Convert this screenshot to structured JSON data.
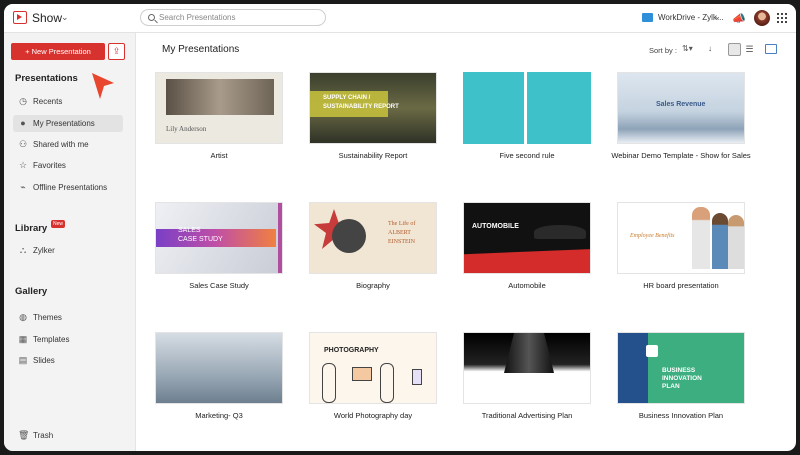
{
  "app": {
    "name": "Show"
  },
  "search": {
    "placeholder": "Search Presentations"
  },
  "workdrive": {
    "label": "WorkDrive - Zylk..."
  },
  "sidebar": {
    "new_button": "+ New Presentation",
    "sections": {
      "presentations": "Presentations",
      "library": "Library",
      "library_badge": "New",
      "gallery": "Gallery"
    },
    "items": [
      {
        "label": "Recents",
        "icon": "clock-icon"
      },
      {
        "label": "My Presentations",
        "icon": "user-icon"
      },
      {
        "label": "Shared with me",
        "icon": "shared-icon"
      },
      {
        "label": "Favorites",
        "icon": "star-icon"
      },
      {
        "label": "Offline Presentations",
        "icon": "offline-icon"
      },
      {
        "label": "Zylker",
        "icon": "library-icon"
      },
      {
        "label": "Themes",
        "icon": "palette-icon"
      },
      {
        "label": "Templates",
        "icon": "templates-icon"
      },
      {
        "label": "Slides",
        "icon": "slides-icon"
      },
      {
        "label": "Trash",
        "icon": "trash-icon"
      }
    ]
  },
  "main": {
    "title": "My Presentations",
    "sort_label": "Sort by :",
    "cards": [
      {
        "name": "Artist",
        "thumb_text": [
          "Lily Anderson"
        ]
      },
      {
        "name": "Sustainability Report",
        "thumb_text": [
          "SUPPLY CHAIN /",
          "SUSTAINABILITY REPORT"
        ]
      },
      {
        "name": "Five second rule",
        "thumb_text": []
      },
      {
        "name": "Webinar Demo Template - Show for Sales",
        "thumb_text": [
          "Sales Revenue"
        ]
      },
      {
        "name": "Sales Case Study",
        "thumb_text": [
          "SALES",
          "CASE STUDY"
        ]
      },
      {
        "name": "Biography",
        "thumb_text": [
          "The Life of",
          "ALBERT",
          "EINSTEIN"
        ]
      },
      {
        "name": "Automobile",
        "thumb_text": [
          "AUTOMOBILE"
        ]
      },
      {
        "name": "HR board presentation",
        "thumb_text": [
          "Employee Benefits"
        ]
      },
      {
        "name": "Marketing- Q3",
        "thumb_text": []
      },
      {
        "name": "World Photography day",
        "thumb_text": [
          "PHOTOGRAPHY"
        ]
      },
      {
        "name": "Traditional Advertising Plan",
        "thumb_text": [
          "TRADITIONAL ADVERTISING PLAN"
        ]
      },
      {
        "name": "Business Innovation Plan",
        "thumb_text": [
          "BUSINESS",
          "INNOVATION",
          "PLAN"
        ]
      }
    ]
  },
  "colors": {
    "accent": "#d8322f",
    "sidebar_bg": "#f3f3f3"
  }
}
